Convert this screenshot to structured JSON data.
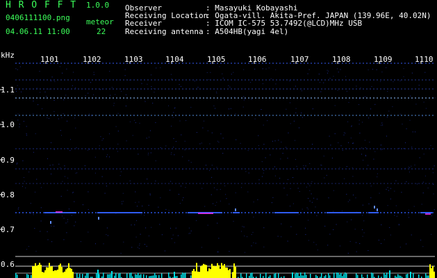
{
  "app": {
    "title": "H R O F F T",
    "version": "1.0.0",
    "filename": "0406111100.png",
    "datetime": "04.06.11 11:00",
    "meteor_label": "meteor",
    "meteor_count": "22"
  },
  "info": {
    "labels": [
      "Observer",
      "Receiving Location",
      "Receiver",
      "Receiving antenna"
    ],
    "values": [
      ": Masayuki Kobayashi",
      ": Ogata-vill. Akita-Pref. JAPAN (139.96E, 40.02N)",
      ": ICOM IC-575 53.7492(@LCD)MHz USB",
      ": A504HB(yagi 4el)"
    ]
  },
  "axis": {
    "unit": "kHz",
    "time_ticks": [
      "1101",
      "1102",
      "1103",
      "1104",
      "1105",
      "1106",
      "1107",
      "1108",
      "1109",
      "1110"
    ],
    "freq_ticks": [
      "1.1",
      "1.0",
      "0.9",
      "0.8",
      "0.7",
      "0.6"
    ]
  },
  "colors": {
    "title_green": "#3cff5a",
    "grid": "#3d5f8f",
    "signal_blue": "#2f5cff",
    "signal_magenta": "#ff33ff",
    "bar_yellow": "#ffff00",
    "bar_cyan": "#00e0e8"
  }
}
